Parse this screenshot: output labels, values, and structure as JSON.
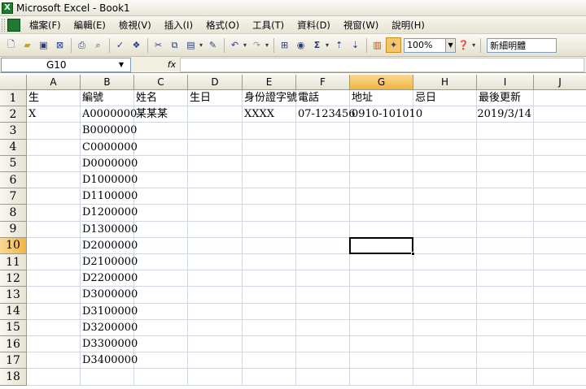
{
  "window": {
    "title": "Microsoft Excel - Book1"
  },
  "menu": [
    "檔案(F)",
    "編輯(E)",
    "檢視(V)",
    "插入(I)",
    "格式(O)",
    "工具(T)",
    "資料(D)",
    "視窗(W)",
    "說明(H)"
  ],
  "toolbar": {
    "icons": [
      "new-icon",
      "open-icon",
      "save-icon",
      "permission-icon",
      "print-icon",
      "print-preview-icon",
      "spelling-icon",
      "research-icon",
      "cut-icon",
      "copy-icon",
      "paste-icon",
      "format-painter-icon",
      "undo-icon",
      "redo-icon",
      "hyperlink-icon",
      "insert-link-icon",
      "autosum-icon",
      "sort-ascending-icon",
      "sort-descending-icon",
      "chart-wizard-icon",
      "drawing-icon"
    ],
    "zoom": "100%",
    "font": "新細明體"
  },
  "formula_bar": {
    "name_box": "G10",
    "fx_label": "fx",
    "formula": ""
  },
  "sheet": {
    "columns": [
      "A",
      "B",
      "C",
      "D",
      "E",
      "F",
      "G",
      "H",
      "I",
      "J"
    ],
    "active_column": "G",
    "active_row": "10",
    "rows": [
      {
        "n": "1",
        "cells": [
          "生",
          "編號",
          "姓名",
          "生日",
          "身份證字號",
          "電話",
          "地址",
          "忌日",
          "最後更新",
          ""
        ]
      },
      {
        "n": "2",
        "cells": [
          "X",
          "A0000000",
          "某某某",
          "",
          "XXXX",
          "07-123456",
          "0910-101010",
          "",
          "2019/3/14",
          ""
        ]
      },
      {
        "n": "3",
        "cells": [
          "",
          "B0000000",
          "",
          "",
          "",
          "",
          "",
          "",
          "",
          ""
        ]
      },
      {
        "n": "4",
        "cells": [
          "",
          "C0000000",
          "",
          "",
          "",
          "",
          "",
          "",
          "",
          ""
        ]
      },
      {
        "n": "5",
        "cells": [
          "",
          "D0000000",
          "",
          "",
          "",
          "",
          "",
          "",
          "",
          ""
        ]
      },
      {
        "n": "6",
        "cells": [
          "",
          "D1000000",
          "",
          "",
          "",
          "",
          "",
          "",
          "",
          ""
        ]
      },
      {
        "n": "7",
        "cells": [
          "",
          "D1100000",
          "",
          "",
          "",
          "",
          "",
          "",
          "",
          ""
        ]
      },
      {
        "n": "8",
        "cells": [
          "",
          "D1200000",
          "",
          "",
          "",
          "",
          "",
          "",
          "",
          ""
        ]
      },
      {
        "n": "9",
        "cells": [
          "",
          "D1300000",
          "",
          "",
          "",
          "",
          "",
          "",
          "",
          ""
        ]
      },
      {
        "n": "10",
        "cells": [
          "",
          "D2000000",
          "",
          "",
          "",
          "",
          "",
          "",
          "",
          ""
        ]
      },
      {
        "n": "11",
        "cells": [
          "",
          "D2100000",
          "",
          "",
          "",
          "",
          "",
          "",
          "",
          ""
        ]
      },
      {
        "n": "12",
        "cells": [
          "",
          "D2200000",
          "",
          "",
          "",
          "",
          "",
          "",
          "",
          ""
        ]
      },
      {
        "n": "13",
        "cells": [
          "",
          "D3000000",
          "",
          "",
          "",
          "",
          "",
          "",
          "",
          ""
        ]
      },
      {
        "n": "14",
        "cells": [
          "",
          "D3100000",
          "",
          "",
          "",
          "",
          "",
          "",
          "",
          ""
        ]
      },
      {
        "n": "15",
        "cells": [
          "",
          "D3200000",
          "",
          "",
          "",
          "",
          "",
          "",
          "",
          ""
        ]
      },
      {
        "n": "16",
        "cells": [
          "",
          "D3300000",
          "",
          "",
          "",
          "",
          "",
          "",
          "",
          ""
        ]
      },
      {
        "n": "17",
        "cells": [
          "",
          "D3400000",
          "",
          "",
          "",
          "",
          "",
          "",
          "",
          ""
        ]
      },
      {
        "n": "18",
        "cells": [
          "",
          "",
          "",
          "",
          "",
          "",
          "",
          "",
          "",
          ""
        ]
      }
    ]
  }
}
